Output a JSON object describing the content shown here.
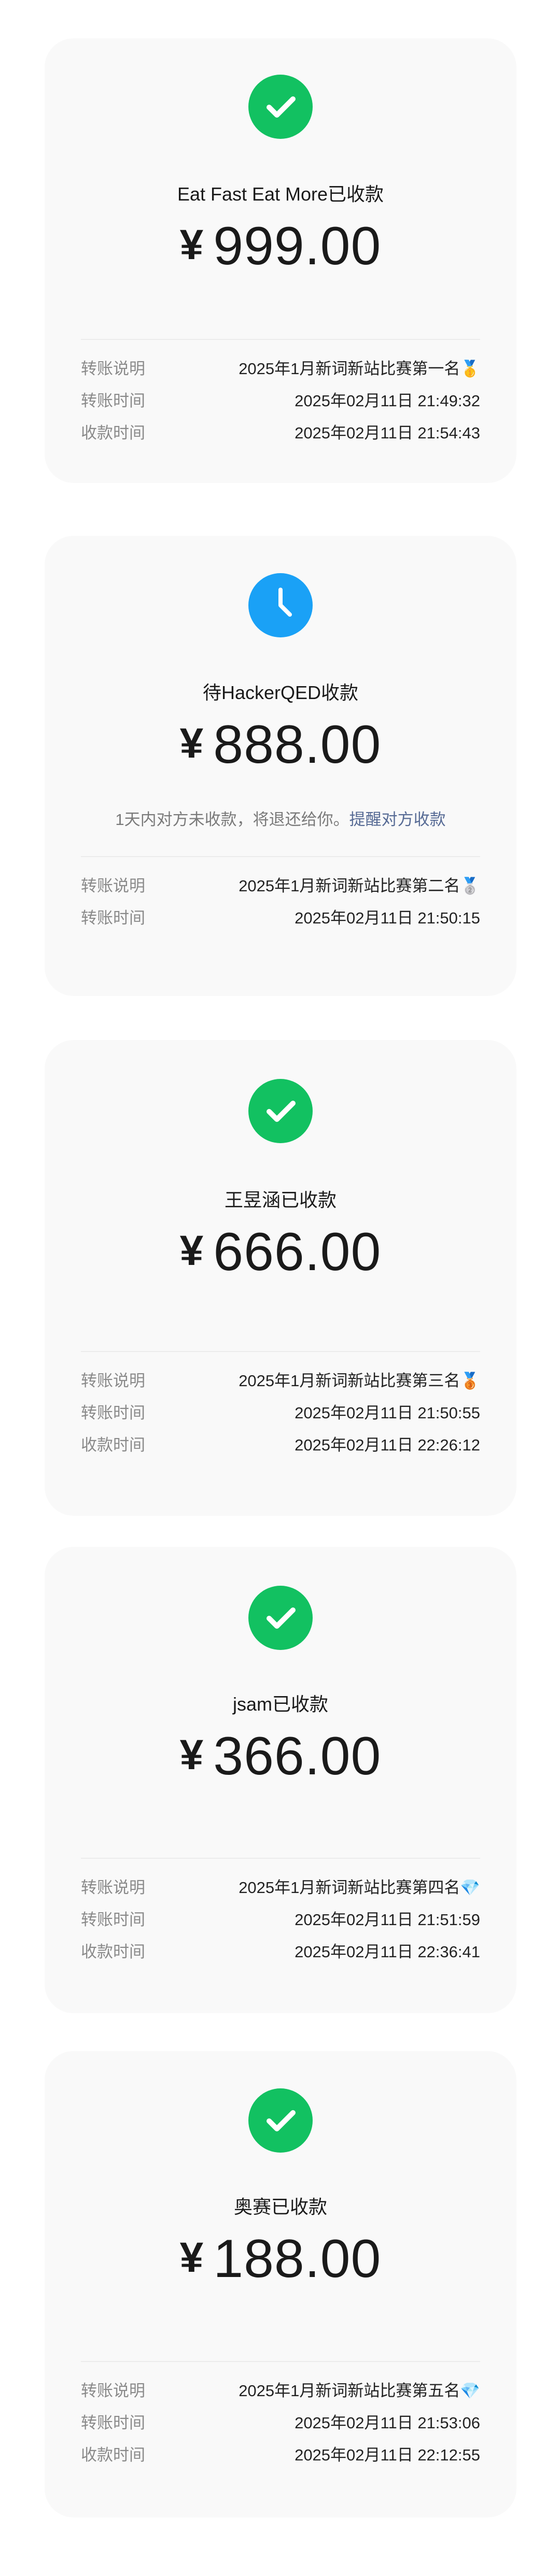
{
  "colors": {
    "success_green": "#12c161",
    "pending_blue": "#1aa1f6",
    "link": "#576b95"
  },
  "cards": [
    {
      "status_icon": "check-icon",
      "payee_status": "Eat Fast Eat More已收款",
      "currency": "¥",
      "amount": "999.00",
      "hint": null,
      "rows": [
        {
          "label": "转账说明",
          "value": "2025年1月新词新站比赛第一名🥇"
        },
        {
          "label": "转账时间",
          "value": "2025年02月11日 21:49:32"
        },
        {
          "label": "收款时间",
          "value": "2025年02月11日 21:54:43"
        }
      ]
    },
    {
      "status_icon": "clock-icon",
      "payee_status": "待HackerQED收款",
      "currency": "¥",
      "amount": "888.00",
      "hint": {
        "text": "1天内对方未收款，将退还给你。",
        "link": "提醒对方收款"
      },
      "rows": [
        {
          "label": "转账说明",
          "value": "2025年1月新词新站比赛第二名🥈"
        },
        {
          "label": "转账时间",
          "value": "2025年02月11日 21:50:15"
        }
      ]
    },
    {
      "status_icon": "check-icon",
      "payee_status": "王昱涵已收款",
      "currency": "¥",
      "amount": "666.00",
      "hint": null,
      "rows": [
        {
          "label": "转账说明",
          "value": "2025年1月新词新站比赛第三名🥉"
        },
        {
          "label": "转账时间",
          "value": "2025年02月11日 21:50:55"
        },
        {
          "label": "收款时间",
          "value": "2025年02月11日 22:26:12"
        }
      ]
    },
    {
      "status_icon": "check-icon",
      "payee_status": "jsam已收款",
      "currency": "¥",
      "amount": "366.00",
      "hint": null,
      "rows": [
        {
          "label": "转账说明",
          "value": "2025年1月新词新站比赛第四名💎"
        },
        {
          "label": "转账时间",
          "value": "2025年02月11日 21:51:59"
        },
        {
          "label": "收款时间",
          "value": "2025年02月11日 22:36:41"
        }
      ]
    },
    {
      "status_icon": "check-icon",
      "payee_status": "奥赛已收款",
      "currency": "¥",
      "amount": "188.00",
      "hint": null,
      "rows": [
        {
          "label": "转账说明",
          "value": "2025年1月新词新站比赛第五名💎"
        },
        {
          "label": "转账时间",
          "value": "2025年02月11日 21:53:06"
        },
        {
          "label": "收款时间",
          "value": "2025年02月11日 22:12:55"
        }
      ]
    }
  ]
}
